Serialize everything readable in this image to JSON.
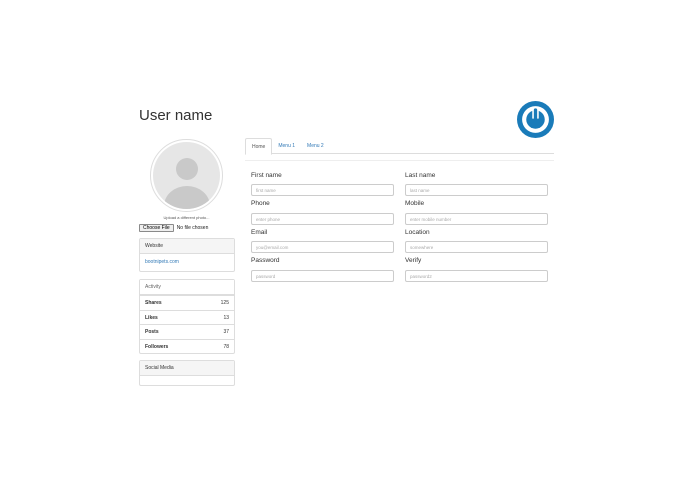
{
  "header": {
    "title": "User name",
    "logo_icon": "power-logo-icon",
    "logo_color": "#1a7bb9"
  },
  "profile": {
    "avatar_icon": "user-silhouette-icon",
    "upload_caption": "Upload a different photo...",
    "file_button_label": "Choose File",
    "file_status": "No file chosen"
  },
  "website": {
    "heading": "Website",
    "link": "bootnipets.com"
  },
  "activity": {
    "heading": "Activity",
    "stats": [
      {
        "label": "Shares",
        "value": "125"
      },
      {
        "label": "Likes",
        "value": "13"
      },
      {
        "label": "Posts",
        "value": "37"
      },
      {
        "label": "Followers",
        "value": "78"
      }
    ]
  },
  "social": {
    "heading": "Social Media"
  },
  "tabs": [
    {
      "label": "Home",
      "active": true
    },
    {
      "label": "Menu 1",
      "active": false
    },
    {
      "label": "Menu 2",
      "active": false
    }
  ],
  "form": {
    "first_name": {
      "label": "First name",
      "placeholder": "first name"
    },
    "last_name": {
      "label": "Last name",
      "placeholder": "last name"
    },
    "phone": {
      "label": "Phone",
      "placeholder": "enter phone"
    },
    "mobile": {
      "label": "Mobile",
      "placeholder": "enter mobile number"
    },
    "email": {
      "label": "Email",
      "placeholder": "you@email.com"
    },
    "location": {
      "label": "Location",
      "placeholder": "somewhere"
    },
    "password": {
      "label": "Password",
      "placeholder": "password"
    },
    "verify": {
      "label": "Verify",
      "placeholder": "password2"
    }
  },
  "colors": {
    "link": "#337ab7",
    "panel_heading_bg": "#f5f5f5",
    "border": "#dddddd"
  }
}
